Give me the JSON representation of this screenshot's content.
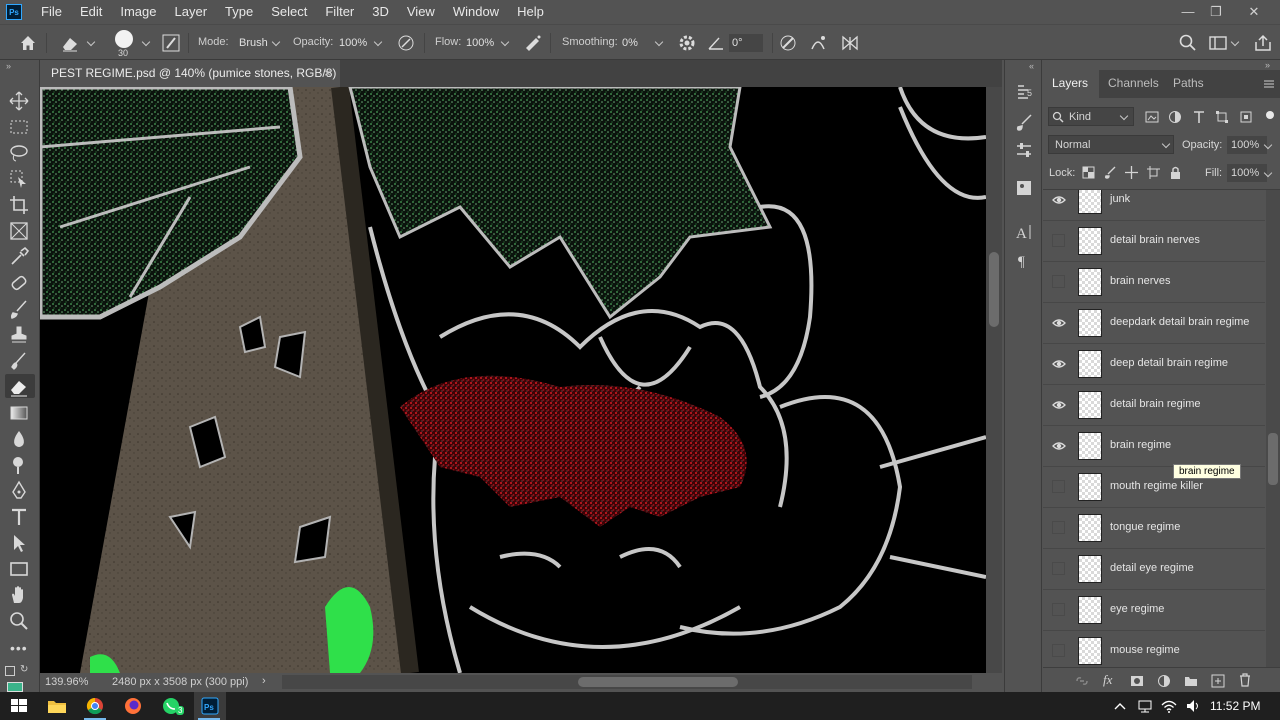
{
  "app": {
    "logo": "Ps",
    "menu": [
      "File",
      "Edit",
      "Image",
      "Layer",
      "Type",
      "Select",
      "Filter",
      "3D",
      "View",
      "Window",
      "Help"
    ],
    "window_controls": [
      "minimize-icon",
      "restore-icon",
      "close-icon"
    ]
  },
  "options": {
    "brush_size": "30",
    "mode_label": "Mode:",
    "mode_value": "Brush",
    "opacity_label": "Opacity:",
    "opacity_value": "100%",
    "flow_label": "Flow:",
    "flow_value": "100%",
    "smoothing_label": "Smoothing:",
    "smoothing_value": "0%",
    "angle_value": "0°"
  },
  "document": {
    "tab_title": "PEST REGIME.psd @ 140% (pumice stones, RGB/8) *",
    "tab_close": "×"
  },
  "status": {
    "zoom": "139.96%",
    "dimensions": "2480 px x 3508 px (300 ppi)",
    "arrow": "›"
  },
  "layers_panel": {
    "tabs": [
      "Layers",
      "Channels",
      "Paths"
    ],
    "filter_kind": "Kind",
    "blend_mode": "Normal",
    "opacity_label": "Opacity:",
    "opacity_value": "100%",
    "lock_label": "Lock:",
    "fill_label": "Fill:",
    "fill_value": "100%",
    "layers": [
      {
        "name": "junk",
        "visible": true
      },
      {
        "name": "detail brain nerves",
        "visible": false
      },
      {
        "name": "brain nerves",
        "visible": false
      },
      {
        "name": "deepdark detail brain regime",
        "visible": true
      },
      {
        "name": "deep detail brain regime",
        "visible": true
      },
      {
        "name": "detail brain regime",
        "visible": true
      },
      {
        "name": "brain regime",
        "visible": true
      },
      {
        "name": "mouth regime killer",
        "visible": false
      },
      {
        "name": "tongue regime",
        "visible": false
      },
      {
        "name": "detail eye regime",
        "visible": false
      },
      {
        "name": "eye regime",
        "visible": false
      },
      {
        "name": "mouse regime",
        "visible": false
      }
    ],
    "tooltip": "brain regime"
  },
  "taskbar": {
    "clock": "11:52 PM",
    "apps": [
      "windows-start-icon",
      "file-explorer-icon",
      "chrome-icon",
      "firefox-icon",
      "whatsapp-icon",
      "photoshop-icon"
    ],
    "whatsapp_badge": "3",
    "tray": [
      "tray-chevron-icon",
      "network-icon",
      "wifi-icon",
      "volume-icon"
    ]
  },
  "colors": {
    "ui_bg": "#535353",
    "canvas_bg": "#000000",
    "accent": "#31a8ff",
    "red_brain": "#b3101a",
    "green_leaf": "#3f8f4a"
  }
}
